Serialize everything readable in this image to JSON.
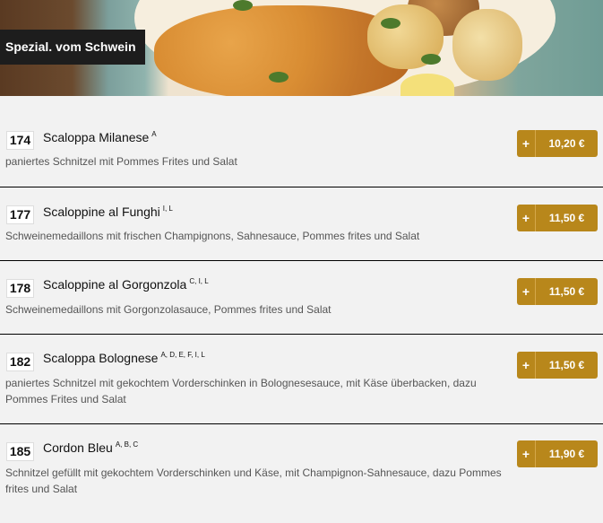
{
  "category": {
    "title": "Spezial. vom Schwein"
  },
  "items": [
    {
      "number": "174",
      "name": "Scaloppa Milanese",
      "allergens": "A",
      "description": "paniertes Schnitzel mit Pommes Frites und Salat",
      "add": "+",
      "price": "10,20 €"
    },
    {
      "number": "177",
      "name": "Scaloppine al Funghi",
      "allergens": "I, L",
      "description": "Schweinemedaillons mit frischen Champignons, Sahnesauce, Pommes frites und Salat",
      "add": "+",
      "price": "11,50 €"
    },
    {
      "number": "178",
      "name": "Scaloppine al Gorgonzola",
      "allergens": "C, I, L",
      "description": "Schweinemedaillons mit Gorgonzolasauce, Pommes frites und Salat",
      "add": "+",
      "price": "11,50 €"
    },
    {
      "number": "182",
      "name": "Scaloppa Bolognese",
      "allergens": "A, D, E, F, I, L",
      "description_line1": "paniertes Schnitzel mit gekochtem Vorderschinken in Bolognesesauce, mit Käse überbacken, dazu",
      "description_line2": "Pommes Frites und Salat",
      "add": "+",
      "price": "11,50 €"
    },
    {
      "number": "185",
      "name": "Cordon Bleu",
      "allergens": "A, B, C",
      "description_line1": "Schnitzel gefüllt mit gekochtem Vorderschinken und Käse, mit Champignon-Sahnesauce, dazu Pommes",
      "description_line2": "frites und Salat",
      "add": "+",
      "price": "11,90 €"
    }
  ],
  "colors": {
    "accent": "#b8871b",
    "label_bg": "#1d1d1d",
    "background": "#f2f2f2"
  }
}
